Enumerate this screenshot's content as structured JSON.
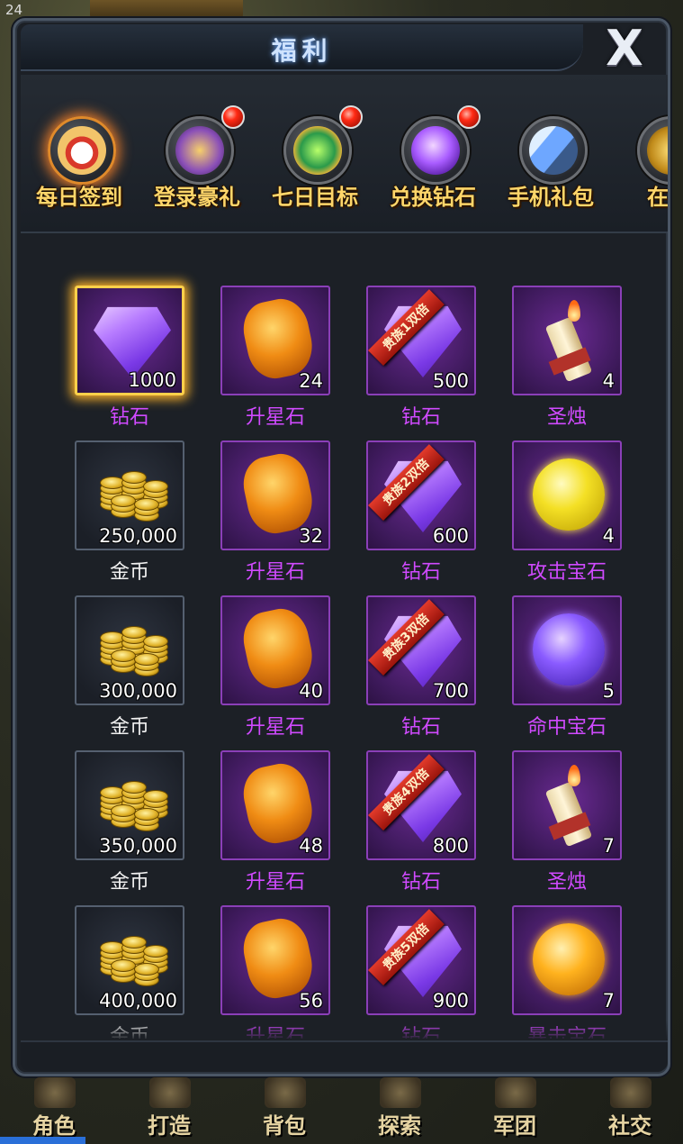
{
  "hud": {
    "level": "24"
  },
  "dialog": {
    "title": "福利",
    "close_label": "X"
  },
  "tabs": [
    {
      "label": "每日签到",
      "icon": "calendar-icon",
      "active": true,
      "badge": false
    },
    {
      "label": "登录豪礼",
      "icon": "treasure-chest-icon",
      "active": false,
      "badge": true
    },
    {
      "label": "七日目标",
      "icon": "seven-target-icon",
      "active": false,
      "badge": true
    },
    {
      "label": "兑换钻石",
      "icon": "diamond-icon",
      "active": false,
      "badge": true
    },
    {
      "label": "手机礼包",
      "icon": "phone-icon",
      "active": false,
      "badge": false
    },
    {
      "label": "在线",
      "icon": "online-gift-icon",
      "active": false,
      "badge": false
    }
  ],
  "rewards": [
    {
      "name": "钻石",
      "count": "1000",
      "type": "diamond",
      "selected": true
    },
    {
      "name": "升星石",
      "count": "24",
      "type": "amber"
    },
    {
      "name": "钻石",
      "count": "500",
      "type": "diamond",
      "ribbon": "贵族1双倍"
    },
    {
      "name": "圣烛",
      "count": "4",
      "type": "candle"
    },
    {
      "name": "金币",
      "count": "250,000",
      "type": "coins"
    },
    {
      "name": "升星石",
      "count": "32",
      "type": "amber"
    },
    {
      "name": "钻石",
      "count": "600",
      "type": "diamond",
      "ribbon": "贵族2双倍"
    },
    {
      "name": "攻击宝石",
      "count": "4",
      "type": "gem-yellow"
    },
    {
      "name": "金币",
      "count": "300,000",
      "type": "coins"
    },
    {
      "name": "升星石",
      "count": "40",
      "type": "amber"
    },
    {
      "name": "钻石",
      "count": "700",
      "type": "diamond",
      "ribbon": "贵族3双倍"
    },
    {
      "name": "命中宝石",
      "count": "5",
      "type": "gem-violet"
    },
    {
      "name": "金币",
      "count": "350,000",
      "type": "coins"
    },
    {
      "name": "升星石",
      "count": "48",
      "type": "amber"
    },
    {
      "name": "钻石",
      "count": "800",
      "type": "diamond",
      "ribbon": "贵族4双倍"
    },
    {
      "name": "圣烛",
      "count": "7",
      "type": "candle"
    },
    {
      "name": "金币",
      "count": "400,000",
      "type": "coins"
    },
    {
      "name": "升星石",
      "count": "56",
      "type": "amber"
    },
    {
      "name": "钻石",
      "count": "900",
      "type": "diamond",
      "ribbon": "贵族5双倍"
    },
    {
      "name": "暴击宝石",
      "count": "7",
      "type": "gem-orange"
    }
  ],
  "nav": [
    {
      "label": "角色",
      "icon": "helmet-icon"
    },
    {
      "label": "打造",
      "icon": "anvil-icon"
    },
    {
      "label": "背包",
      "icon": "backpack-icon"
    },
    {
      "label": "探索",
      "icon": "compass-icon"
    },
    {
      "label": "军团",
      "icon": "legion-icon"
    },
    {
      "label": "社交",
      "icon": "social-icon"
    }
  ]
}
